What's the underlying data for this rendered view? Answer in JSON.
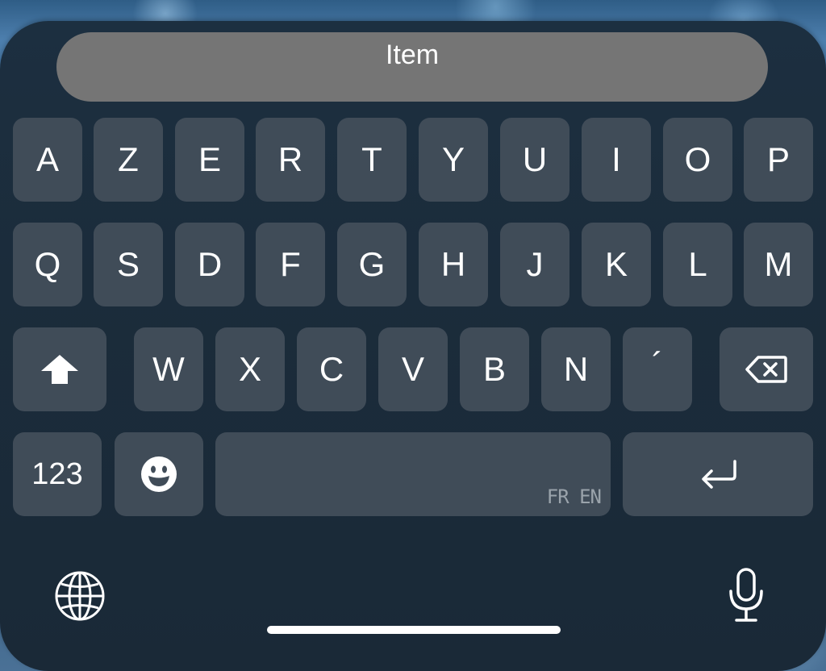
{
  "suggestion_bar": {
    "text": "Item"
  },
  "rows": {
    "row1": [
      "A",
      "Z",
      "E",
      "R",
      "T",
      "Y",
      "U",
      "I",
      "O",
      "P"
    ],
    "row2": [
      "Q",
      "S",
      "D",
      "F",
      "G",
      "H",
      "J",
      "K",
      "L",
      "M"
    ],
    "row3": [
      "W",
      "X",
      "C",
      "V",
      "B",
      "N",
      "´"
    ]
  },
  "keys": {
    "numbers_label": "123",
    "space_languages": "FR EN",
    "shift_icon": "shift-arrow-icon",
    "delete_icon": "backspace-icon",
    "emoji_icon": "emoji-smiley-icon",
    "return_icon": "return-arrow-icon",
    "globe_icon": "globe-icon",
    "mic_icon": "microphone-icon"
  },
  "colors": {
    "key_background": "#404c58",
    "keyboard_background": "#1c2f40",
    "suggestion_background": "#757575",
    "text": "#ffffff"
  }
}
